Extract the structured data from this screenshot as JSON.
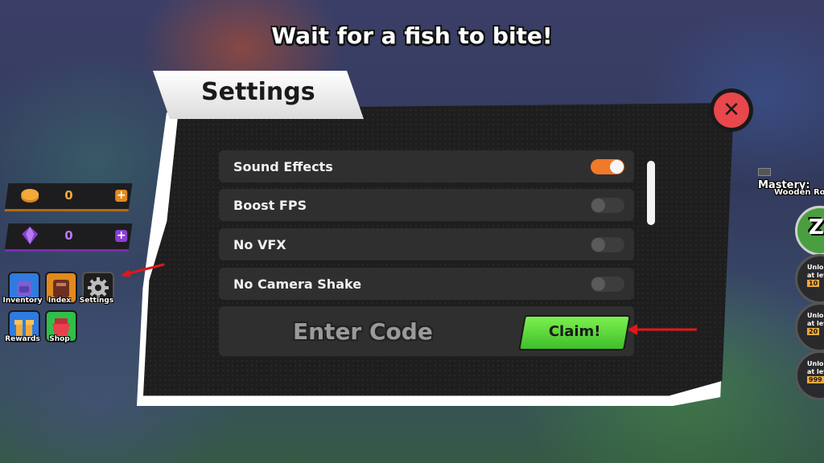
{
  "hint": "Wait for a fish to bite!",
  "hud": {
    "coins": "0",
    "gems": "0",
    "add_symbol": "+",
    "menu": [
      {
        "label": "Inventory",
        "icon": "backpack-icon",
        "color": "#2f7be0"
      },
      {
        "label": "Index",
        "icon": "book-icon",
        "color": "#e08a1e"
      },
      {
        "label": "Settings",
        "icon": "gear-icon",
        "color": "#1e1e1e"
      },
      {
        "label": "Rewards",
        "icon": "gift-icon",
        "color": "#2f7be0"
      },
      {
        "label": "Shop",
        "icon": "shop-icon",
        "color": "#2fbf4a"
      }
    ],
    "mastery_label": "Mastery:",
    "mastery_item": "Wooden Ro",
    "skill_key": "Z",
    "skills": [
      {
        "line1": "Unlo",
        "line2": "at lev",
        "level": "10"
      },
      {
        "line1": "Unlo",
        "line2": "at lev",
        "level": "20"
      },
      {
        "line1": "Unlo",
        "line2": "at lev",
        "level": "999"
      }
    ]
  },
  "settings": {
    "title": "Settings",
    "close_symbol": "✕",
    "options": [
      {
        "label": "Sound Effects",
        "enabled": true
      },
      {
        "label": "Boost FPS",
        "enabled": false
      },
      {
        "label": "No VFX",
        "enabled": false
      },
      {
        "label": "No Camera Shake",
        "enabled": false
      }
    ],
    "code_placeholder": "Enter Code",
    "claim_label": "Claim!"
  },
  "colors": {
    "toggle_on": "#f0792a",
    "claim_green": "#5fd83a",
    "close_red": "#e8474b",
    "annotation_arrow": "#e01818"
  }
}
